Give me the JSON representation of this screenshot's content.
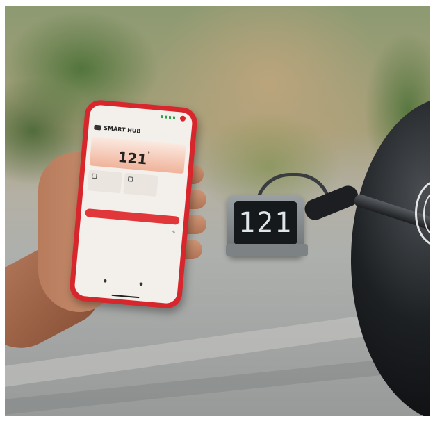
{
  "phone": {
    "app_title": "SMART HUB",
    "probe_label": "",
    "current_temp": "121",
    "target_temp": "",
    "section_label": "",
    "progress_text": "",
    "tile_1": "",
    "tile_2": ""
  },
  "hub_display": {
    "reading": "121"
  },
  "colors": {
    "phone_case": "#d7262c",
    "accent": "#e2373a",
    "screen_bg": "#f3efea"
  }
}
